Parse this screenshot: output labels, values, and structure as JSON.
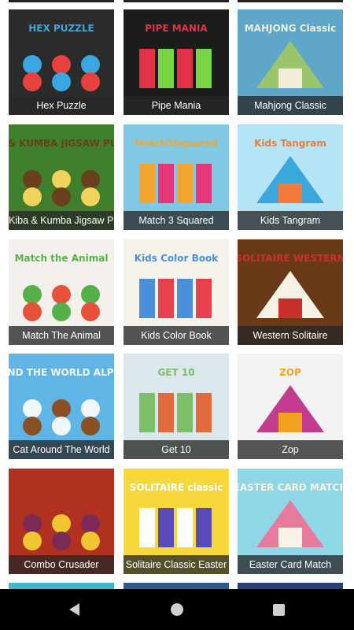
{
  "games": [
    {
      "title": "Hex Puzzle",
      "art_label": "HEX PUZZLE",
      "icon": "hex-puzzle-icon",
      "colors": [
        "#2b2b2b",
        "#e8413d",
        "#39a7e0"
      ]
    },
    {
      "title": "Pipe Mania",
      "art_label": "PIPE MANIA",
      "icon": "pipe-mania-icon",
      "colors": [
        "#1c1c1c",
        "#78d645",
        "#e23245"
      ]
    },
    {
      "title": "Mahjong Classic",
      "art_label": "MAHJONG Classic",
      "icon": "mahjong-icon",
      "colors": [
        "#5ea7c8",
        "#9ac56a",
        "#f1ecd8"
      ]
    },
    {
      "title": "Kiba & Kumba Jigsaw Puzzle",
      "art_label": "KIBA & KUMBA JIGSAW PUZZLE",
      "icon": "kiba-kumba-icon",
      "colors": [
        "#3f7e2a",
        "#f2d35b",
        "#6a3f1e"
      ]
    },
    {
      "title": "Match 3 Squared",
      "art_label": "Match3Squared",
      "icon": "match3-icon",
      "colors": [
        "#7fc9e6",
        "#e5367c",
        "#f4a531"
      ]
    },
    {
      "title": "Kids Tangram",
      "art_label": "Kids Tangram",
      "icon": "tangram-icon",
      "colors": [
        "#b5e4f5",
        "#3aa7dd",
        "#f27b39"
      ]
    },
    {
      "title": "Match The Animal",
      "art_label": "Match the Animal",
      "icon": "match-animal-icon",
      "colors": [
        "#f4f1ec",
        "#e8503a",
        "#56b04a"
      ]
    },
    {
      "title": "Kids Color Book",
      "art_label": "Kids Color Book",
      "icon": "color-book-icon",
      "colors": [
        "#f4f2ea",
        "#e7414e",
        "#4a8fd8"
      ]
    },
    {
      "title": "Western Solitaire",
      "art_label": "SOLITAIRE WESTERN",
      "icon": "western-solitaire-icon",
      "colors": [
        "#6a3a18",
        "#f6f2e6",
        "#c9302c"
      ]
    },
    {
      "title": "Cat Around The World",
      "art_label": "CAT AROUND THE WORLD ALPINE LAKES",
      "icon": "cat-world-icon",
      "colors": [
        "#5fb6e6",
        "#8a4f23",
        "#f0f7fb"
      ]
    },
    {
      "title": "Get 10",
      "art_label": "GET 10",
      "icon": "get10-icon",
      "colors": [
        "#dbe7ec",
        "#e36a3d",
        "#7cc06a"
      ]
    },
    {
      "title": "Zop",
      "art_label": "ZOP",
      "icon": "zop-icon",
      "colors": [
        "#f3f3f3",
        "#c23b8e",
        "#f0a21f"
      ]
    },
    {
      "title": "Combo Crusader",
      "art_label": "",
      "icon": "combo-crusader-icon",
      "colors": [
        "#b0311f",
        "#f2c533",
        "#7b2a55"
      ]
    },
    {
      "title": "Solitaire Classic Easter",
      "art_label": "SOLITAIRE classic",
      "icon": "solitaire-easter-icon",
      "colors": [
        "#f6d83b",
        "#5a4ab7",
        "#ffffff"
      ]
    },
    {
      "title": "Easter Card Match",
      "art_label": "EASTER CARD MATCH",
      "icon": "easter-card-icon",
      "colors": [
        "#8fd6e6",
        "#e77a9d",
        "#f8f3e4"
      ]
    }
  ],
  "partial_row_colors": [
    "#3fb7c7",
    "#2e5b8a",
    "#2a3e78"
  ],
  "navbar": {
    "back": "back-icon",
    "home": "home-icon",
    "recents": "recents-icon"
  }
}
